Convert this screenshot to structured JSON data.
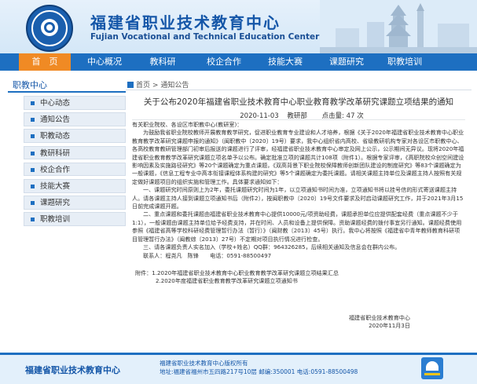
{
  "header": {
    "title": "福建省职业技术教育中心",
    "subtitle": "Fujian Vocational and Technical Education Center"
  },
  "nav": {
    "items": [
      "首　页",
      "中心概况",
      "教科研",
      "校企合作",
      "技能大赛",
      "课题研究",
      "职教培训"
    ],
    "active_index": 0
  },
  "sidebar": {
    "title": "职教中心",
    "items": [
      "中心动态",
      "通知公告",
      "职教动态",
      "教研科研",
      "校企合作",
      "技能大赛",
      "课题研究",
      "职教培训"
    ]
  },
  "breadcrumb": {
    "home": "首页",
    "sep": ">",
    "current": "通知公告"
  },
  "article": {
    "title": "关于公布2020年福建省职业技术教育中心职业教育教学改革研究课题立项结果的通知",
    "date": "2020-11-03",
    "department": "教研部",
    "views_label": "点击量:",
    "views": "47",
    "views_unit": "次",
    "greeting": "有关职业院校、各设区市职教中心(教研室)：",
    "paragraphs": [
      "为鼓励我省职业院校教师开展教育教学研究，促进职业教育专业建设和人才培养，根据《关于2020年福建省职业技术教育中心职业教育教学改革研究课题申报的通知》（闽职教中〔2020〕19号）要求，我中心组织省内高校、省级教研机构专家对各设区市职教中心、各高校教育教研管理部门初审后报送的课题进行了评审，经福建省职业技术教育中心审定及网上公示，公示期间无异议。现将2020年福建省职业教育教学改革研究课题立项名单予以公布。确定批准立项的课题共计108项（附件1）。根据专家评审，《高职院校众创空间建设影响因素及实施路径研究》等20个课题确定为重点课题，《双高背景下职业院校保障教师创新团队建设的制度研究》等83个课题确定为一般课题，《信息工程专业中高本衔接课程体系构建的研究》等5个课题确定为委托课题。请相关课题主持单位及课题主持人按照有关规定做好课题项目的组织实施和管理工作。具体要求通知如下：",
      "一、课题研究时间原则上为2年，委托课题研究时间为1年，以立项通知书时间为准，立项通知书将以挂号信的形式寄送课题主持人。请各课题主持人接到课题立项通知书后（附件2），按闽职教中〔2020〕19号文件要求及时启动课题研究工作，并于2021年3月15日前完成课题开题。",
      "二、重点课题和委托课题由福建省职业技术教育中心提供10000元/项资助经费，课题承担单位应提供配套经费（重点课题不少于1:1），一般课题由课题主持单位给予经费支持，并在时间、人员和设备上提供保障。资助课题经费的拨付事宜另行通知。课题经费使用参照《福建省高等学校科研经费管理暂行办法（暂行）》（闽财教〔2013〕45号）执行。我中心将按照《福建省中青年教师教育科研项目管理暂行办法》（闽教综〔2013〕27号）不定期对项目执行情况进行检查。",
      "三、请各课题负责人实名加入（学校+姓名）QQ群：964326285，后续相关通知及信息会在群内公布。"
    ],
    "contact": "联系人：程尧凡　陈锋　　电话：0591-88500497",
    "attachments": [
      "附件：1.2020年福建省职业技术教育中心职业教育教学改革研究课题立项结果汇总",
      "2.2020年度福建省职业教育教学改革研究课题立项通知书"
    ],
    "signature_org": "福建省职业技术教育中心",
    "signature_date": "2020年11月3日"
  },
  "footer": {
    "site_name": "福建省职业技术教育中心",
    "copyright": "福建省职业技术教育中心版权所有",
    "address": "地址:福建省福州市五四路217号10层  邮编:350001  电话:0591-88500498"
  }
}
